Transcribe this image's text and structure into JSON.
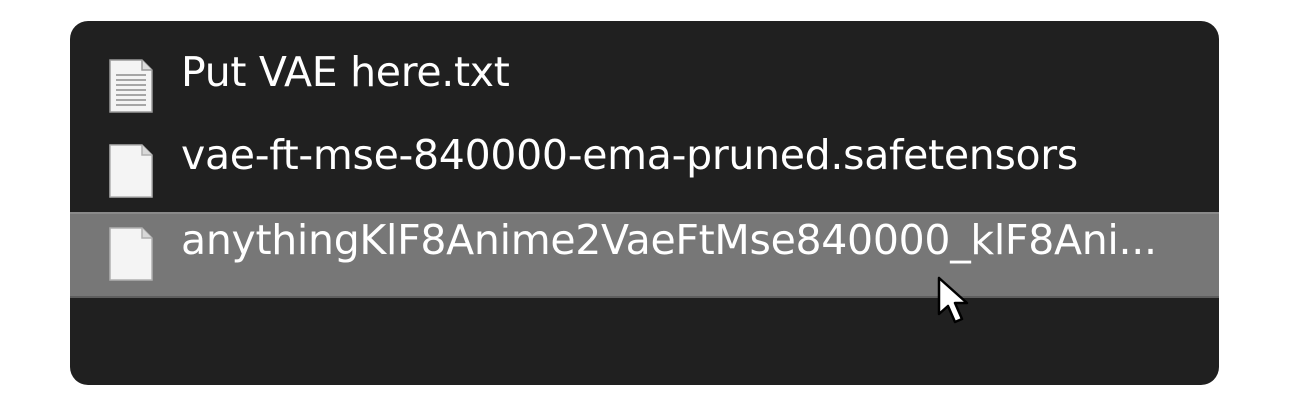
{
  "file_list": {
    "items": [
      {
        "name": "Put VAE here.txt",
        "icon": "text-file-icon",
        "selected": false
      },
      {
        "name": "vae-ft-mse-840000-ema-pruned.safetensors",
        "icon": "blank-file-icon",
        "selected": false
      },
      {
        "name": "anythingKlF8Anime2VaeFtMse840000_klF8Ani...",
        "icon": "blank-file-icon",
        "selected": true
      }
    ]
  },
  "colors": {
    "panel_background": "#202020",
    "selected_row": "#777777",
    "text": "#ffffff"
  },
  "cursor": {
    "icon": "mouse-pointer-icon"
  }
}
